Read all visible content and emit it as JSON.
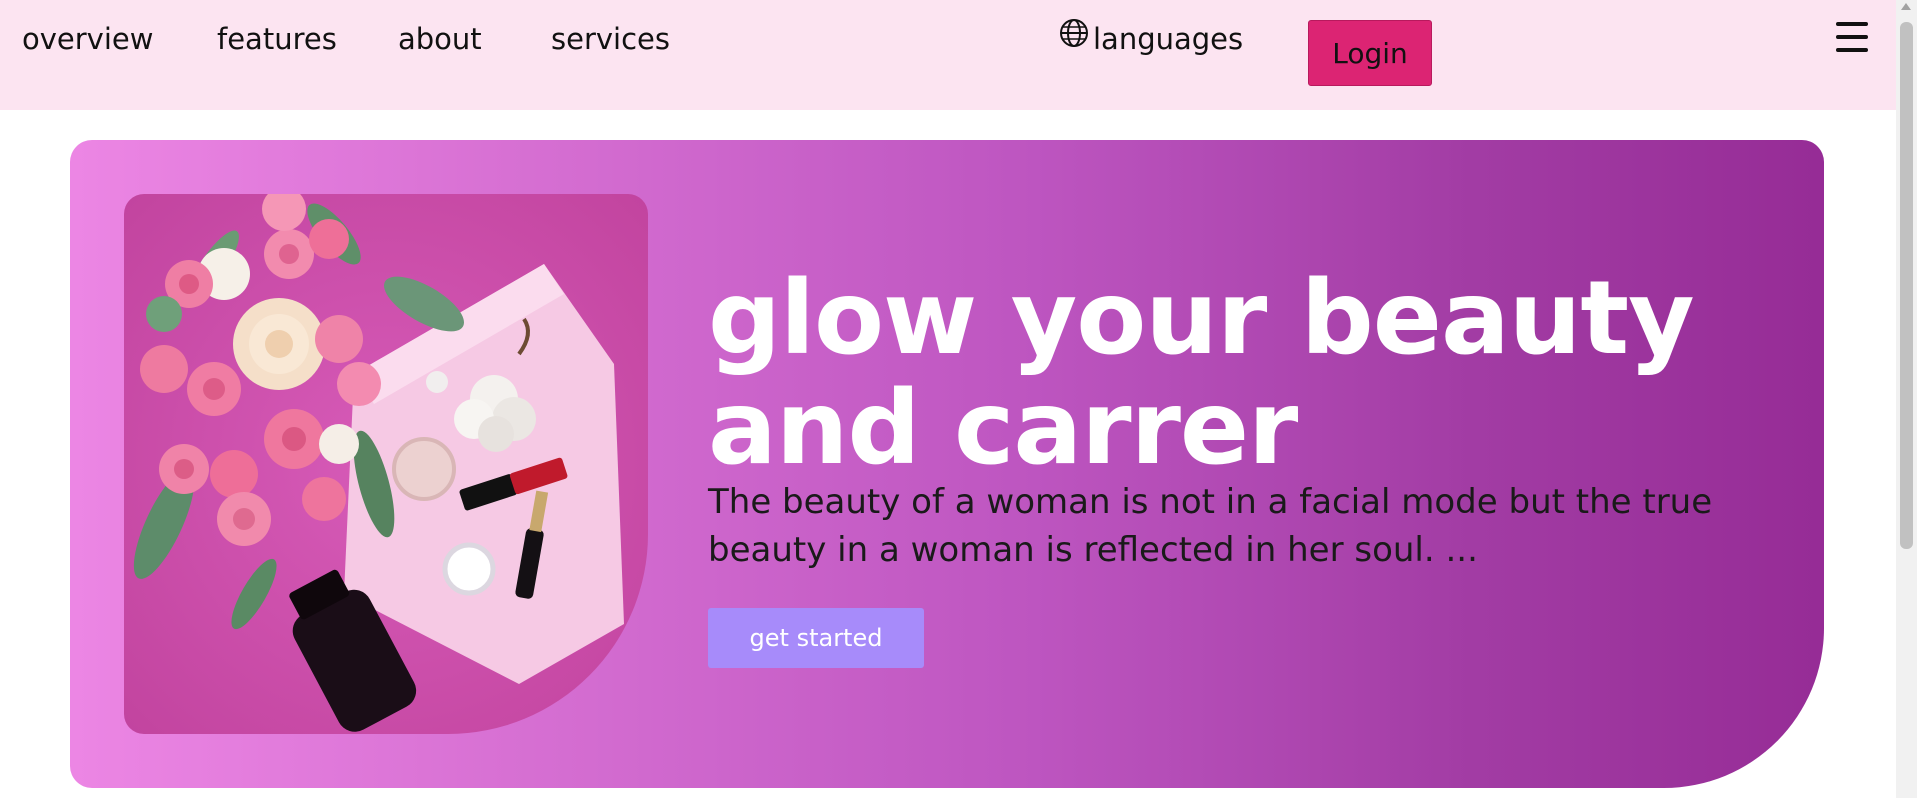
{
  "nav": {
    "links": [
      "overview",
      "features",
      "about",
      "services"
    ],
    "languages_label": "languages",
    "login_label": "Login"
  },
  "hero": {
    "title_line1": "glow your beauty",
    "title_line2": "and carrer",
    "description": "The beauty of a woman is not in a facial mode but the true beauty in a woman is reflected in her soul. ...",
    "cta_label": "get started"
  },
  "colors": {
    "navbar_bg": "#fce4f1",
    "login_bg": "#dc2473",
    "hero_gradient_start": "#ec86e4",
    "hero_gradient_end": "#962c96",
    "cta_bg": "#a78bfa"
  }
}
